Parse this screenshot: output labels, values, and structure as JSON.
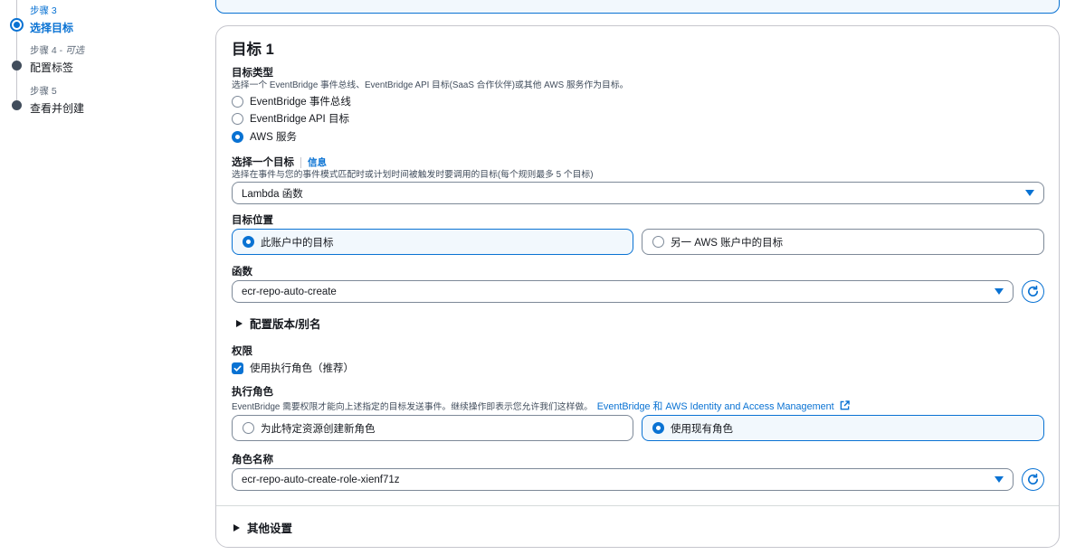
{
  "stepper": {
    "steps": [
      {
        "number": "步骤 3",
        "title": "选择目标",
        "state": "active"
      },
      {
        "number": "步骤 4",
        "optional": "可选",
        "title": "配置标签",
        "state": "pending"
      },
      {
        "number": "步骤 5",
        "title": "查看并创建",
        "state": "pending"
      }
    ]
  },
  "target": {
    "heading": "目标 1",
    "type": {
      "label": "目标类型",
      "description": "选择一个 EventBridge 事件总线、EventBridge API 目标(SaaS 合作伙伴)或其他 AWS 服务作为目标。",
      "options": [
        "EventBridge 事件总线",
        "EventBridge API 目标",
        "AWS 服务"
      ],
      "selected": "AWS 服务"
    },
    "select_target": {
      "label": "选择一个目标",
      "info_link": "信息",
      "description": "选择在事件与您的事件模式匹配时或计划时间被触发时要调用的目标(每个规则最多 5 个目标)",
      "value": "Lambda 函数"
    },
    "location": {
      "label": "目标位置",
      "options": [
        "此账户中的目标",
        "另一 AWS 账户中的目标"
      ],
      "selected": "此账户中的目标"
    },
    "function": {
      "label": "函数",
      "value": "ecr-repo-auto-create"
    },
    "version_alias": {
      "label": "配置版本/别名"
    },
    "permissions": {
      "label": "权限",
      "checkbox_label": "使用执行角色（推荐）",
      "checked": true
    },
    "execution_role": {
      "label": "执行角色",
      "description": "EventBridge 需要权限才能向上述指定的目标发送事件。继续操作即表示您允许我们这样做。",
      "link": "EventBridge 和 AWS Identity and Access Management",
      "options": [
        "为此特定资源创建新角色",
        "使用现有角色"
      ],
      "selected": "使用现有角色"
    },
    "role_name": {
      "label": "角色名称",
      "value": "ecr-repo-auto-create-role-xienf71z"
    },
    "other_settings": {
      "label": "其他设置"
    }
  },
  "colors": {
    "accent": "#0972d3",
    "text": "#16191f",
    "border": "#7d8998",
    "selected_bg": "#f2f8fd"
  }
}
